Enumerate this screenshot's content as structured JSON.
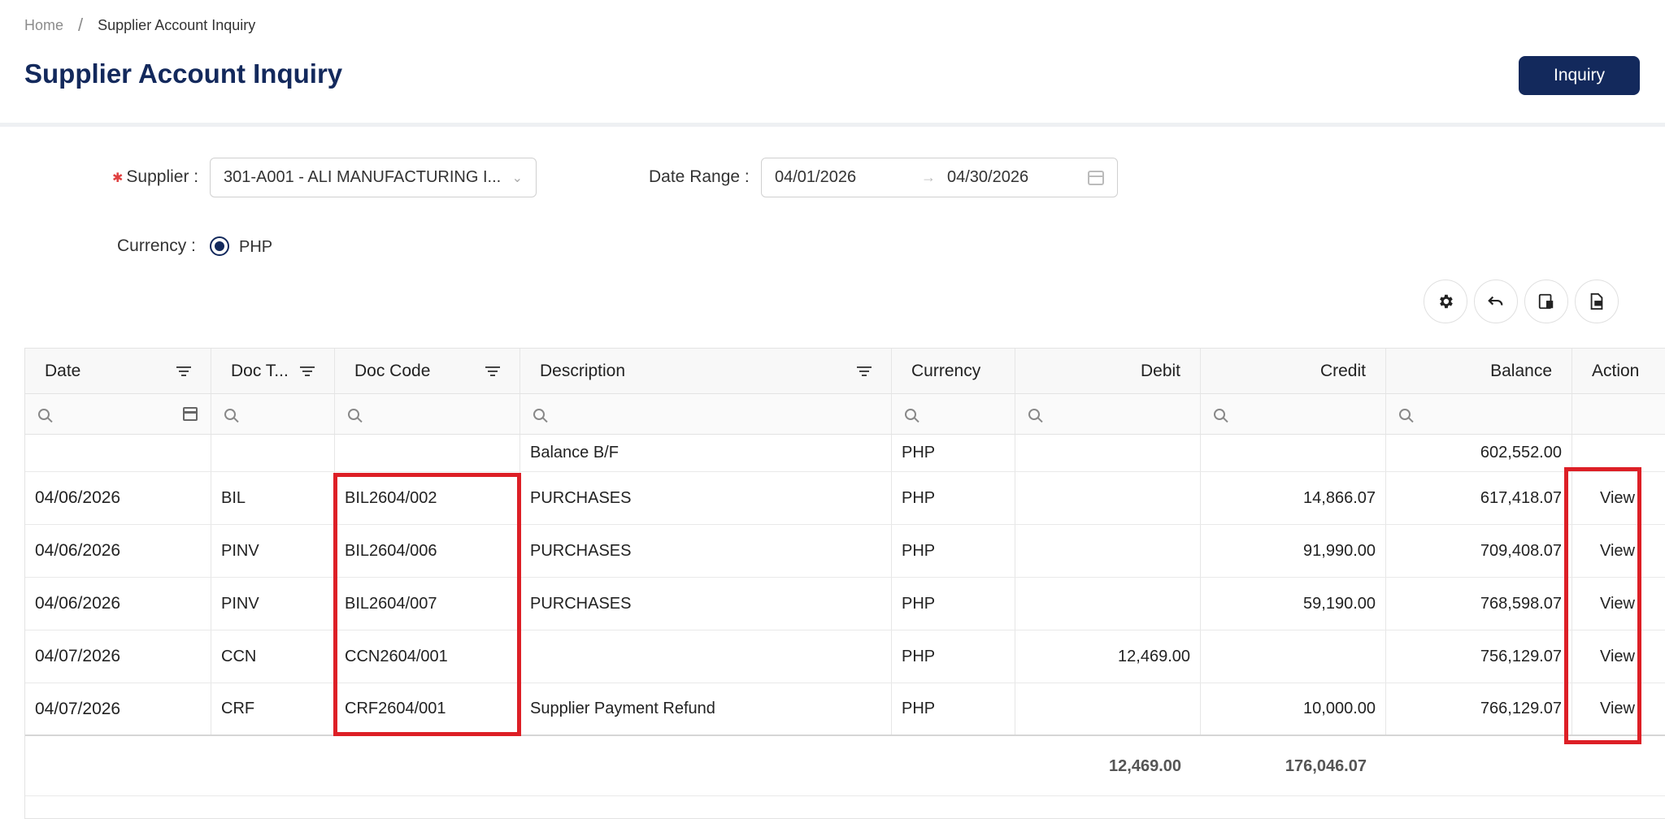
{
  "breadcrumb": {
    "home": "Home",
    "separator": "/",
    "current": "Supplier Account Inquiry"
  },
  "header": {
    "title": "Supplier Account Inquiry",
    "inquiry_button": "Inquiry"
  },
  "filters": {
    "supplier_label": "Supplier :",
    "supplier_value": "301-A001 - ALI MANUFACTURING I...",
    "date_range_label": "Date Range :",
    "date_from": "04/01/2026",
    "date_arrow": "→",
    "date_to": "04/30/2026",
    "currency_label": "Currency :",
    "currency_option": "PHP"
  },
  "toolbar": {
    "icons": [
      "gear-icon",
      "undo-icon",
      "column-settings-icon",
      "export-icon"
    ]
  },
  "table": {
    "columns": [
      "Date",
      "Doc T...",
      "Doc Code",
      "Description",
      "Currency",
      "Debit",
      "Credit",
      "Balance",
      "Action"
    ],
    "balance_bf": {
      "description": "Balance B/F",
      "currency": "PHP",
      "balance": "602,552.00"
    },
    "rows": [
      {
        "date": "04/06/2026",
        "doc_type": "BIL",
        "doc_code": "BIL2604/002",
        "description": "PURCHASES",
        "currency": "PHP",
        "debit": "",
        "credit": "14,866.07",
        "balance": "617,418.07",
        "action": "View"
      },
      {
        "date": "04/06/2026",
        "doc_type": "PINV",
        "doc_code": "BIL2604/006",
        "description": "PURCHASES",
        "currency": "PHP",
        "debit": "",
        "credit": "91,990.00",
        "balance": "709,408.07",
        "action": "View"
      },
      {
        "date": "04/06/2026",
        "doc_type": "PINV",
        "doc_code": "BIL2604/007",
        "description": "PURCHASES",
        "currency": "PHP",
        "debit": "",
        "credit": "59,190.00",
        "balance": "768,598.07",
        "action": "View"
      },
      {
        "date": "04/07/2026",
        "doc_type": "CCN",
        "doc_code": "CCN2604/001",
        "description": "",
        "currency": "PHP",
        "debit": "12,469.00",
        "credit": "",
        "balance": "756,129.07",
        "action": "View"
      },
      {
        "date": "04/07/2026",
        "doc_type": "CRF",
        "doc_code": "CRF2604/001",
        "description": "Supplier Payment Refund",
        "currency": "PHP",
        "debit": "",
        "credit": "10,000.00",
        "balance": "766,129.07",
        "action": "View"
      }
    ],
    "totals": {
      "debit": "12,469.00",
      "credit": "176,046.07"
    }
  },
  "colors": {
    "primary": "#13295c",
    "link": "#4aa3e0",
    "highlight": "#dd1f26"
  }
}
